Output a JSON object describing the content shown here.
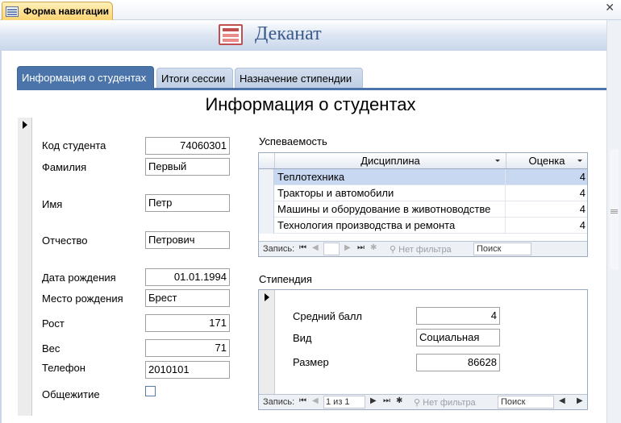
{
  "doc_tab": {
    "label": "Форма навигации",
    "close": "✕"
  },
  "header": {
    "title": "Деканат"
  },
  "nav_tabs": [
    {
      "label": "Информация о студентах",
      "active": true
    },
    {
      "label": "Итоги сессии",
      "active": false
    },
    {
      "label": "Назначение стипендии",
      "active": false
    }
  ],
  "page_title": "Информация о студентах",
  "fields": {
    "student_id": {
      "label": "Код студента",
      "value": "74060301"
    },
    "last_name": {
      "label": "Фамилия",
      "value": "Первый"
    },
    "first_name": {
      "label": "Имя",
      "value": "Петр"
    },
    "patronymic": {
      "label": "Отчество",
      "value": "Петрович"
    },
    "birth_date": {
      "label": "Дата рождения",
      "value": "01.01.1994"
    },
    "birth_place": {
      "label": "Место рождения",
      "value": "Брест"
    },
    "height": {
      "label": "Рост",
      "value": "171"
    },
    "weight": {
      "label": "Вес",
      "value": "71"
    },
    "phone": {
      "label": "Телефон",
      "value": "2010101"
    },
    "dormitory": {
      "label": "Общежитие",
      "checked": false
    }
  },
  "performance": {
    "label": "Успеваемость",
    "columns": [
      "Дисциплина",
      "Оценка"
    ],
    "rows": [
      {
        "discipline": "Теплотехника",
        "grade": "4"
      },
      {
        "discipline": "Тракторы и автомобили",
        "grade": "4"
      },
      {
        "discipline": "Машины и оборудование в животноводстве",
        "grade": "4"
      },
      {
        "discipline": "Технология производства и ремонта",
        "grade": "4"
      }
    ],
    "navbar": {
      "record_label": "Запись:",
      "record_value": "",
      "filter": "Нет фильтра",
      "search": "Поиск"
    }
  },
  "scholarship": {
    "label": "Стипендия",
    "avg_label": "Средний балл",
    "avg_value": "4",
    "type_label": "Вид",
    "type_value": "Социальная",
    "size_label": "Размер",
    "size_value": "86628",
    "navbar": {
      "record_label": "Запись:",
      "record_value": "1 из 1",
      "filter": "Нет фильтра",
      "search": "Поиск"
    }
  }
}
